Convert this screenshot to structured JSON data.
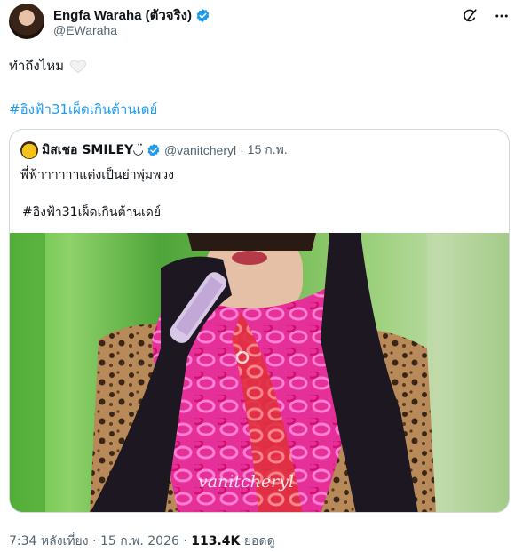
{
  "author": {
    "display_name": "Engfa Waraha (ตัวจริง)",
    "handle": "@EWaraha",
    "avatar_icon": "profile-photo",
    "verified_icon": "verified-badge-icon"
  },
  "top_icons": [
    "grok-icon",
    "more-icon"
  ],
  "tweet": {
    "text": "ทำถึงไหม",
    "emoji": "white-heart",
    "hashtag": "#อิงฟ้า31เผ็ดเกินต้านเดย์"
  },
  "quoted": {
    "display_name": "มิสเชอ SMILEY◡̈",
    "handle": "@vanitcheryl",
    "separator": "·",
    "date": "15 ก.พ.",
    "text": "พี่ฟ้าาาาาาแต่งเป็นย่าพุ่มพวง",
    "hashtag": "#อิงฟ้า31เผ็ดเกินต้านเดย์",
    "media_watermark": "vanitcheryl"
  },
  "footer": {
    "time": "7:34 หลังเที่ยง",
    "sep1": "·",
    "date": "15 ก.พ. 2026",
    "sep2": "·",
    "views": "113.4K",
    "views_label": "ยอดดู"
  },
  "colors": {
    "accent": "#1d9bf0",
    "text": "#0f1419",
    "muted": "#536471",
    "border": "#cfd9de"
  }
}
